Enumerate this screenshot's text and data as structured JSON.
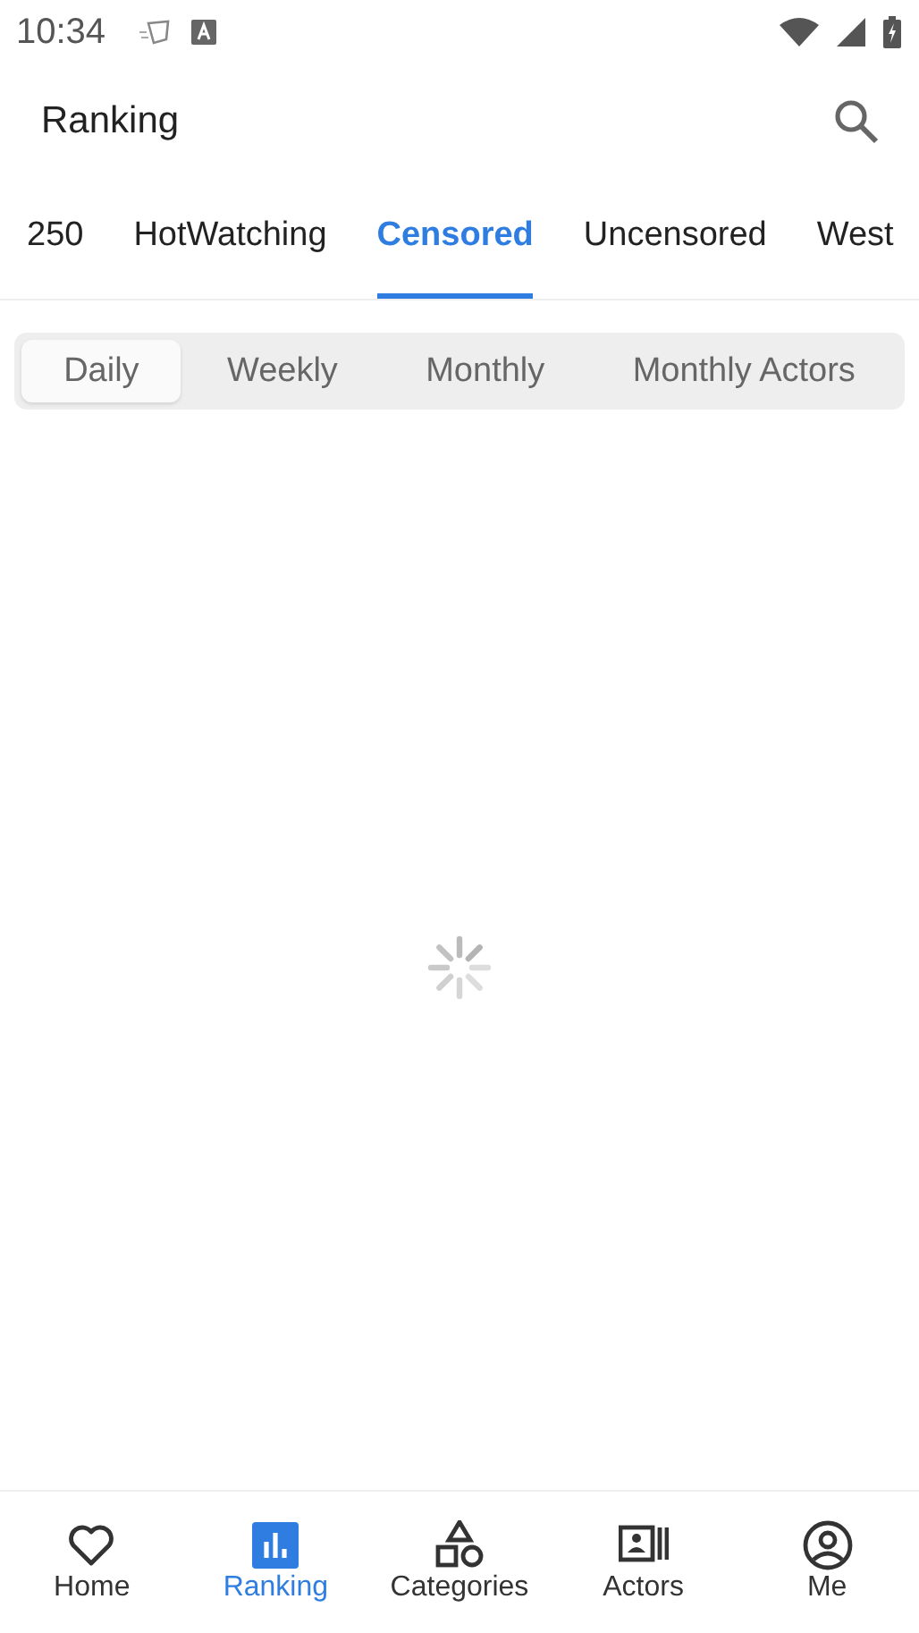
{
  "status_bar": {
    "time": "10:34"
  },
  "app_bar": {
    "title": "Ranking"
  },
  "tabs": [
    {
      "label": "250",
      "selected": false
    },
    {
      "label": "HotWatching",
      "selected": false
    },
    {
      "label": "Censored",
      "selected": true
    },
    {
      "label": "Uncensored",
      "selected": false
    },
    {
      "label": "West",
      "selected": false
    }
  ],
  "periods": [
    {
      "label": "Daily",
      "selected": true
    },
    {
      "label": "Weekly",
      "selected": false
    },
    {
      "label": "Monthly",
      "selected": false
    },
    {
      "label": "Monthly Actors",
      "selected": false
    }
  ],
  "content": {
    "loading": true
  },
  "bottom_nav": [
    {
      "kind": "heart",
      "label": "Home",
      "selected": false
    },
    {
      "kind": "chart",
      "label": "Ranking",
      "selected": true
    },
    {
      "kind": "shapes",
      "label": "Categories",
      "selected": false
    },
    {
      "kind": "contacts",
      "label": "Actors",
      "selected": false
    },
    {
      "kind": "person",
      "label": "Me",
      "selected": false
    }
  ]
}
